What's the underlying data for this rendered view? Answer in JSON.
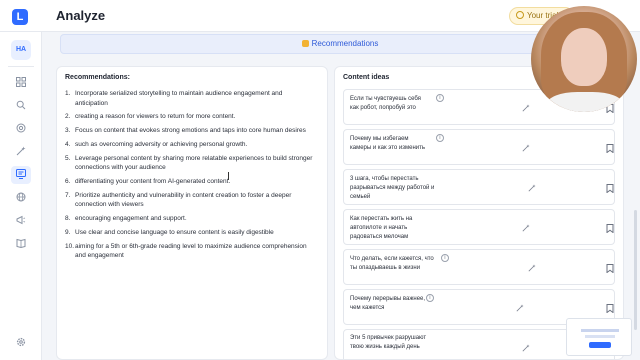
{
  "app": {
    "logo_letter": "L",
    "page_title": "Analyze"
  },
  "header": {
    "trial_text": "Your trial e"
  },
  "sidebar": {
    "avatar_initials": "HA",
    "items": [
      {
        "name": "dashboard"
      },
      {
        "name": "search"
      },
      {
        "name": "target"
      },
      {
        "name": "magic"
      },
      {
        "name": "analyze",
        "active": true
      },
      {
        "name": "globe"
      },
      {
        "name": "megaphone"
      },
      {
        "name": "book"
      },
      {
        "name": "settings"
      }
    ]
  },
  "recommendations_tab": {
    "label": "Recommendations"
  },
  "recommendations": {
    "heading": "Recommendations:",
    "items": [
      {
        "num": "1.",
        "text": "Incorporate serialized storytelling to maintain audience engagement and anticipation"
      },
      {
        "num": "2.",
        "text": "creating a reason for viewers to return for more content."
      },
      {
        "num": "3.",
        "text": "Focus on content that evokes strong emotions and taps into core human desires"
      },
      {
        "num": "4.",
        "text": "such as overcoming adversity or achieving personal growth."
      },
      {
        "num": "5.",
        "text": "Leverage personal content by sharing more relatable experiences to build stronger connections with your audience"
      },
      {
        "num": "6.",
        "text": "differentiating your content from AI-generated content."
      },
      {
        "num": "7.",
        "text": "Prioritize authenticity and vulnerability in content creation to foster a deeper connection with viewers"
      },
      {
        "num": "8.",
        "text": "encouraging engagement and support."
      },
      {
        "num": "9.",
        "text": "Use clear and concise language to ensure content is easily digestible"
      },
      {
        "num": "10.",
        "text": "aiming for a 5th or 6th-grade reading level to maximize audience comprehension and engagement"
      }
    ]
  },
  "content_ideas": {
    "heading": "Content ideas",
    "items": [
      {
        "text": "Если ты чувствуешь себя как робот, попробуй это"
      },
      {
        "text": "Почему мы избегаем камеры и как это изменить"
      },
      {
        "text": "3 шага, чтобы перестать разрываться между работой и семьей"
      },
      {
        "text": "Как перестать жить на автопилоте и начать радоваться мелочам"
      },
      {
        "text": "Что делать, если кажется, что ты опаздываешь в жизни"
      },
      {
        "text": "Почему перерывы важнее, чем кажется"
      },
      {
        "text": "Эти 5 привычек разрушают твою жизнь каждый день"
      }
    ]
  },
  "icons": {
    "info": "i",
    "magic": "magic-wand-icon",
    "bookmark": "bookmark-icon"
  },
  "colors": {
    "accent": "#2f6bff",
    "trial_bg": "#fff6dc",
    "banner_bg": "#e9eefb"
  }
}
